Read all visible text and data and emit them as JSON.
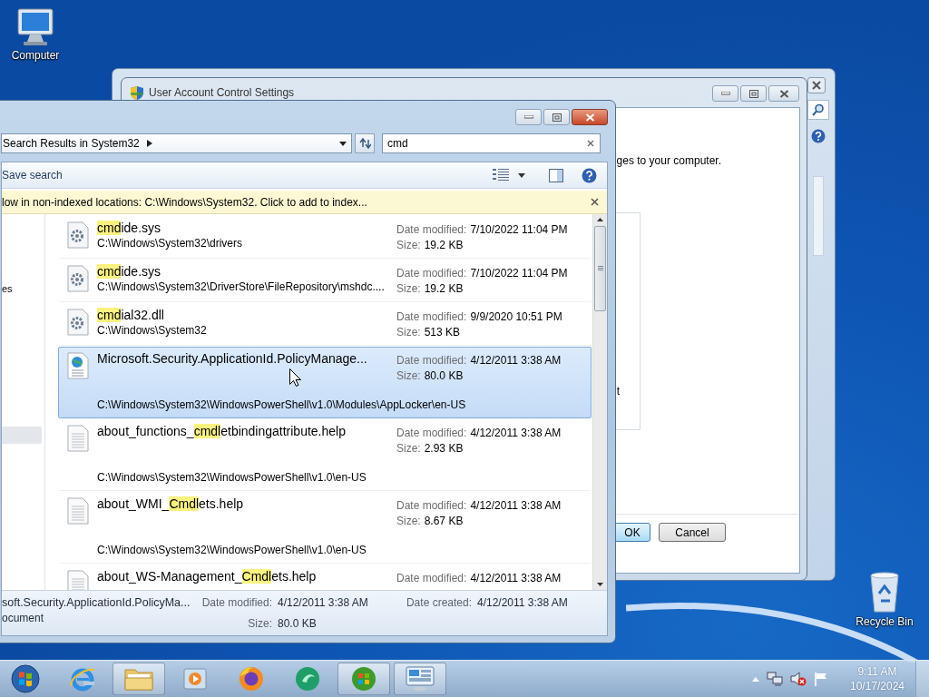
{
  "desktop_icons": [
    {
      "label": "Computer",
      "kind": "computer"
    },
    {
      "label": "Recycle Bin",
      "kind": "recycle"
    }
  ],
  "uac_window": {
    "title": "User Account Control Settings",
    "text": "ges to your computer.",
    "group_text": "t",
    "buttons": [
      {
        "label": "OK",
        "default": true
      },
      {
        "label": "Cancel",
        "default": false
      }
    ]
  },
  "explorer": {
    "address": "Search Results in System32",
    "search": "cmd",
    "save_search": "Save search",
    "info_bar": "low in non-indexed locations: C:\\Windows\\System32. Click to add to index...",
    "nav_text": "es",
    "results": [
      {
        "kind": "sys",
        "selected": false,
        "name": [
          {
            "text": "cmd",
            "match": true
          },
          {
            "text": "ide.sys",
            "match": false
          }
        ],
        "path": "C:\\Windows\\System32\\drivers",
        "meta": [
          {
            "label": "Date modified:",
            "value": "7/10/2022 11:04 PM"
          },
          {
            "label": "Size:",
            "value": "19.2 KB"
          }
        ]
      },
      {
        "kind": "sys",
        "selected": false,
        "name": [
          {
            "text": "cmd",
            "match": true
          },
          {
            "text": "ide.sys",
            "match": false
          }
        ],
        "path": "C:\\Windows\\System32\\DriverStore\\FileRepository\\mshdc....",
        "meta": [
          {
            "label": "Date modified:",
            "value": "7/10/2022 11:04 PM"
          },
          {
            "label": "Size:",
            "value": "19.2 KB"
          }
        ]
      },
      {
        "kind": "sys",
        "selected": false,
        "name": [
          {
            "text": "cmd",
            "match": true
          },
          {
            "text": "ial32.dll",
            "match": false
          }
        ],
        "path": "C:\\Windows\\System32",
        "meta": [
          {
            "label": "Date modified:",
            "value": "9/9/2020 10:51 PM"
          },
          {
            "label": "Size:",
            "value": "513 KB"
          }
        ]
      },
      {
        "kind": "web",
        "selected": true,
        "name": [
          {
            "text": "Microsoft.Security.ApplicationId.PolicyManage...",
            "match": false
          }
        ],
        "path": "C:\\Windows\\System32\\WindowsPowerShell\\v1.0\\Modules\\AppLocker\\en-US",
        "meta": [
          {
            "label": "Date modified:",
            "value": "4/12/2011 3:38 AM"
          },
          {
            "label": "Size:",
            "value": "80.0 KB"
          }
        ]
      },
      {
        "kind": "help",
        "selected": false,
        "name": [
          {
            "text": "about_functions_",
            "match": false
          },
          {
            "text": "cmdl",
            "match": true
          },
          {
            "text": "etbindingattribute.help",
            "match": false
          }
        ],
        "path": "C:\\Windows\\System32\\WindowsPowerShell\\v1.0\\en-US",
        "meta": [
          {
            "label": "Date modified:",
            "value": "4/12/2011 3:38 AM"
          },
          {
            "label": "Size:",
            "value": "2.93 KB"
          }
        ]
      },
      {
        "kind": "help",
        "selected": false,
        "name": [
          {
            "text": "about_WMI_",
            "match": false
          },
          {
            "text": "Cmdl",
            "match": true
          },
          {
            "text": "ets.help",
            "match": false
          }
        ],
        "path": "C:\\Windows\\System32\\WindowsPowerShell\\v1.0\\en-US",
        "meta": [
          {
            "label": "Date modified:",
            "value": "4/12/2011 3:38 AM"
          },
          {
            "label": "Size:",
            "value": "8.67 KB"
          }
        ]
      },
      {
        "kind": "help",
        "selected": false,
        "name": [
          {
            "text": "about_WS-Management_",
            "match": false
          },
          {
            "text": "Cmdl",
            "match": true
          },
          {
            "text": "ets.help",
            "match": false
          }
        ],
        "meta": [
          {
            "label": "Date modified:",
            "value": "4/12/2011 3:38 AM"
          }
        ]
      }
    ],
    "details": {
      "name": "soft.Security.ApplicationId.PolicyMa...",
      "type": "ocument",
      "fields": [
        {
          "label": "Date modified:",
          "value": "4/12/2011 3:38 AM"
        },
        {
          "label": "Size:",
          "value": "80.0 KB"
        },
        {
          "label": "Date created:",
          "value": "4/12/2011 3:38 AM"
        }
      ]
    }
  },
  "taskbar": {
    "apps": [
      {
        "kind": "ie",
        "running": false
      },
      {
        "kind": "folder",
        "running": true
      },
      {
        "kind": "media",
        "running": false
      },
      {
        "kind": "firefox",
        "running": false
      },
      {
        "kind": "green-app",
        "running": false
      },
      {
        "kind": "orb-app",
        "running": true
      },
      {
        "kind": "control-panel",
        "running": true
      }
    ],
    "volume": {
      "muted": true
    },
    "time": "9:11 AM",
    "date": "10/17/2024"
  }
}
